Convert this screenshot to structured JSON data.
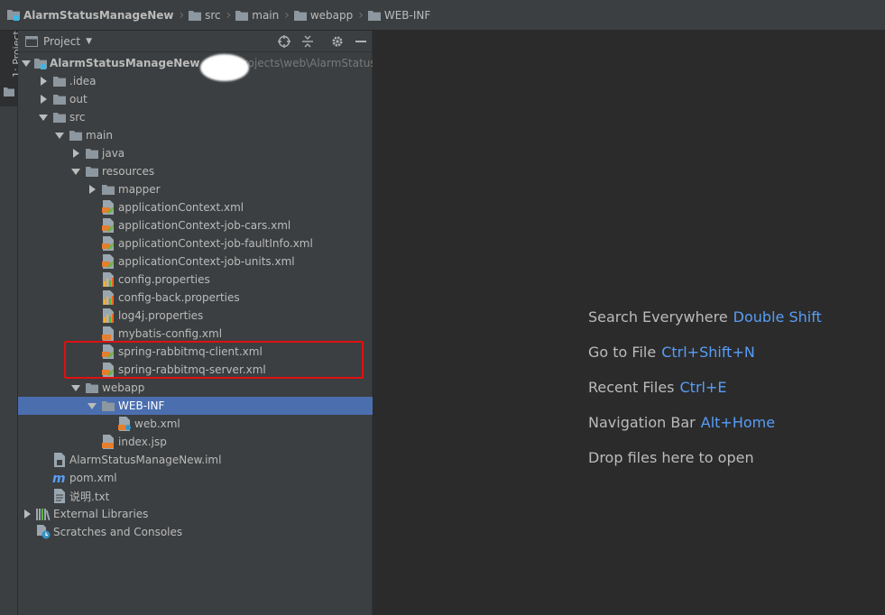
{
  "breadcrumb": [
    {
      "label": "AlarmStatusManageNew",
      "icon": "module-icon",
      "bold": true
    },
    {
      "label": "src",
      "icon": "folder-icon",
      "bold": false
    },
    {
      "label": "main",
      "icon": "folder-icon",
      "bold": false
    },
    {
      "label": "webapp",
      "icon": "folder-icon",
      "bold": false
    },
    {
      "label": "WEB-INF",
      "icon": "folder-icon",
      "bold": false
    }
  ],
  "stripe": {
    "project_label": "1: Project"
  },
  "panel": {
    "title": "Project",
    "buttons": [
      "locate-icon",
      "collapse-all-icon",
      "settings-icon",
      "hide-icon"
    ]
  },
  "tree": [
    {
      "label": "AlarmStatusManageNew",
      "path": "D:\\...\\projects\\web\\AlarmStatusM",
      "indent": 0,
      "arrow": "down",
      "icon": "module-folder-icon",
      "bold": true
    },
    {
      "label": ".idea",
      "indent": 1,
      "arrow": "right",
      "icon": "folder-icon"
    },
    {
      "label": "out",
      "indent": 1,
      "arrow": "right",
      "icon": "folder-icon"
    },
    {
      "label": "src",
      "indent": 1,
      "arrow": "down",
      "icon": "folder-icon"
    },
    {
      "label": "main",
      "indent": 2,
      "arrow": "down",
      "icon": "folder-icon"
    },
    {
      "label": "java",
      "indent": 3,
      "arrow": "right",
      "icon": "folder-icon"
    },
    {
      "label": "resources",
      "indent": 3,
      "arrow": "down",
      "icon": "folder-icon"
    },
    {
      "label": "mapper",
      "indent": 4,
      "arrow": "right",
      "icon": "folder-icon"
    },
    {
      "label": "applicationContext.xml",
      "indent": 4,
      "arrow": "none",
      "icon": "spring-xml-icon"
    },
    {
      "label": "applicationContext-job-cars.xml",
      "indent": 4,
      "arrow": "none",
      "icon": "spring-xml-icon"
    },
    {
      "label": "applicationContext-job-faultInfo.xml",
      "indent": 4,
      "arrow": "none",
      "icon": "spring-xml-icon"
    },
    {
      "label": "applicationContext-job-units.xml",
      "indent": 4,
      "arrow": "none",
      "icon": "spring-xml-icon"
    },
    {
      "label": "config.properties",
      "indent": 4,
      "arrow": "none",
      "icon": "properties-icon"
    },
    {
      "label": "config-back.properties",
      "indent": 4,
      "arrow": "none",
      "icon": "properties-icon"
    },
    {
      "label": "log4j.properties",
      "indent": 4,
      "arrow": "none",
      "icon": "properties-icon"
    },
    {
      "label": "mybatis-config.xml",
      "indent": 4,
      "arrow": "none",
      "icon": "xml-icon"
    },
    {
      "label": "spring-rabbitmq-client.xml",
      "indent": 4,
      "arrow": "none",
      "icon": "spring-xml-icon"
    },
    {
      "label": "spring-rabbitmq-server.xml",
      "indent": 4,
      "arrow": "none",
      "icon": "spring-xml-icon"
    },
    {
      "label": "webapp",
      "indent": 3,
      "arrow": "down",
      "icon": "folder-icon"
    },
    {
      "label": "WEB-INF",
      "indent": 4,
      "arrow": "down",
      "icon": "folder-icon",
      "selected": true
    },
    {
      "label": "web.xml",
      "indent": 5,
      "arrow": "none",
      "icon": "web-xml-icon"
    },
    {
      "label": "index.jsp",
      "indent": 4,
      "arrow": "none",
      "icon": "jsp-icon"
    },
    {
      "label": "AlarmStatusManageNew.iml",
      "indent": 1,
      "arrow": "none",
      "icon": "iml-icon"
    },
    {
      "label": "pom.xml",
      "indent": 1,
      "arrow": "none",
      "icon": "maven-icon"
    },
    {
      "label": "说明.txt",
      "indent": 1,
      "arrow": "none",
      "icon": "text-file-icon"
    },
    {
      "label": "External Libraries",
      "indent": 0,
      "arrow": "right",
      "icon": "libraries-icon"
    },
    {
      "label": "Scratches and Consoles",
      "indent": 0,
      "arrow": "none",
      "icon": "scratches-icon"
    }
  ],
  "editor_hints": [
    {
      "text": "Search Everywhere",
      "key": "Double Shift"
    },
    {
      "text": "Go to File",
      "key": "Ctrl+Shift+N"
    },
    {
      "text": "Recent Files",
      "key": "Ctrl+E"
    },
    {
      "text": "Navigation Bar",
      "key": "Alt+Home"
    },
    {
      "text": "Drop files here to open",
      "key": ""
    }
  ],
  "colors": {
    "accent": "#589df6",
    "selection": "#4b6eaf",
    "highlight": "#e01010",
    "folder": "#8d97a0"
  }
}
